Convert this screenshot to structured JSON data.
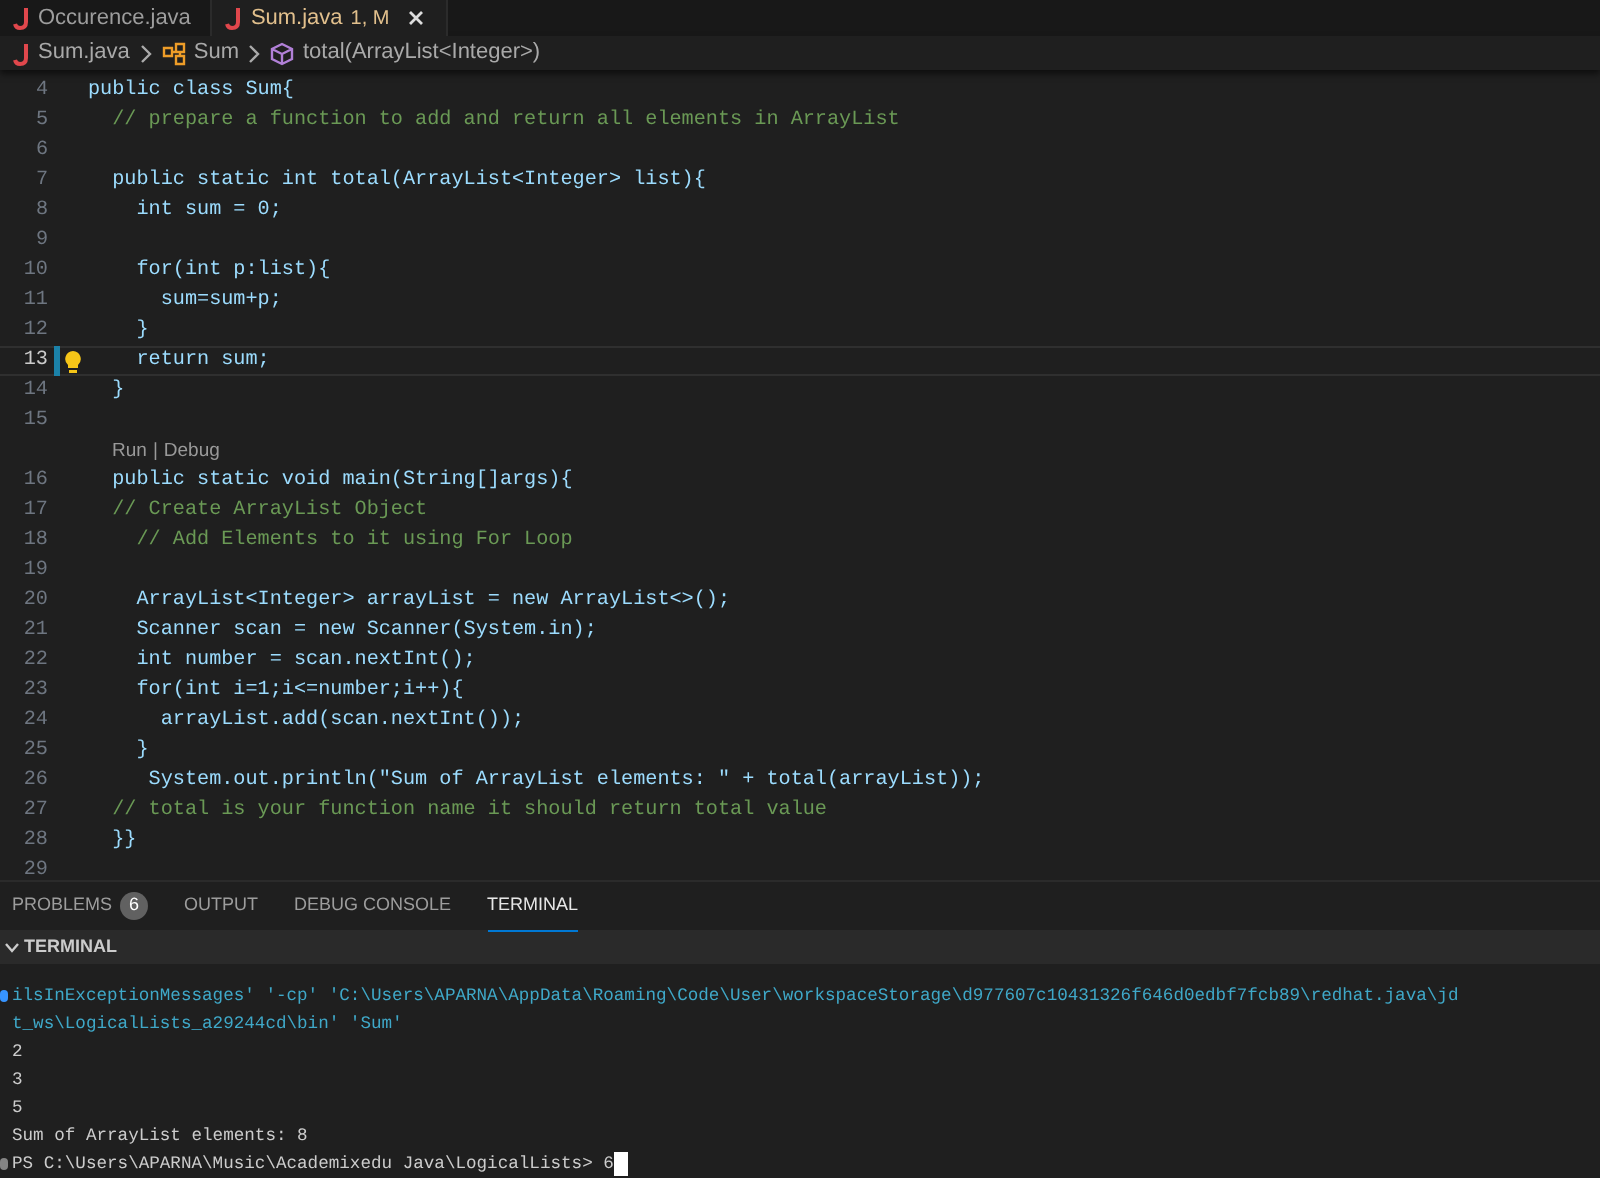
{
  "tabs": [
    {
      "label": "Occurence.java",
      "selected": false
    },
    {
      "label": "Sum.java",
      "badge": "1, M",
      "selected": true
    }
  ],
  "breadcrumbs": [
    {
      "label": "Sum.java",
      "kind": "file"
    },
    {
      "label": "Sum",
      "kind": "class"
    },
    {
      "label": "total(ArrayList<Integer>)",
      "kind": "method"
    }
  ],
  "editor": {
    "lines": [
      {
        "number": "4",
        "text": "public class Sum{",
        "kind": "code",
        "current": false,
        "lightbulb": false
      },
      {
        "number": "5",
        "text": "  // prepare a function to add and return all elements in ArrayList",
        "kind": "comment",
        "current": false,
        "lightbulb": false
      },
      {
        "number": "6",
        "kind": "code",
        "current": false,
        "lightbulb": false
      },
      {
        "number": "7",
        "text": "  public static int total(ArrayList<Integer> list){",
        "kind": "code",
        "current": false,
        "lightbulb": false
      },
      {
        "number": "8",
        "text": "    int sum = 0;",
        "kind": "code",
        "current": false,
        "lightbulb": false
      },
      {
        "number": "9",
        "kind": "code",
        "current": false,
        "lightbulb": false
      },
      {
        "number": "10",
        "text": "    for(int p:list){",
        "kind": "code",
        "current": false,
        "lightbulb": false
      },
      {
        "number": "11",
        "text": "      sum=sum+p;",
        "kind": "code",
        "current": false,
        "lightbulb": false
      },
      {
        "number": "12",
        "text": "    }",
        "kind": "code",
        "current": false,
        "lightbulb": false
      },
      {
        "number": "13",
        "text": "    return sum;",
        "kind": "code",
        "current": true,
        "lightbulb": true
      },
      {
        "number": "14",
        "text": "  }",
        "kind": "code",
        "current": false,
        "lightbulb": false
      },
      {
        "number": "15",
        "kind": "code",
        "current": false,
        "lightbulb": false
      },
      {
        "kind": "codelens",
        "links": [
          "Run",
          "Debug"
        ],
        "separator": "|"
      },
      {
        "number": "16",
        "text": "  public static void main(String[]args){",
        "kind": "code",
        "current": false,
        "lightbulb": false
      },
      {
        "number": "17",
        "text": "  // Create ArrayList Object",
        "kind": "comment",
        "current": false,
        "lightbulb": false
      },
      {
        "number": "18",
        "text": "    // Add Elements to it using For Loop",
        "kind": "comment",
        "current": false,
        "lightbulb": false
      },
      {
        "number": "19",
        "kind": "code",
        "current": false,
        "lightbulb": false
      },
      {
        "number": "20",
        "text": "    ArrayList<Integer> arrayList = new ArrayList<>();",
        "kind": "code",
        "current": false,
        "lightbulb": false
      },
      {
        "number": "21",
        "text": "    Scanner scan = new Scanner(System.in);",
        "kind": "code",
        "current": false,
        "lightbulb": false
      },
      {
        "number": "22",
        "text": "    int number = scan.nextInt();",
        "kind": "code",
        "current": false,
        "lightbulb": false
      },
      {
        "number": "23",
        "text": "    for(int i=1;i<=number;i++){",
        "kind": "code",
        "current": false,
        "lightbulb": false
      },
      {
        "number": "24",
        "text": "      arrayList.add(scan.nextInt());",
        "kind": "code",
        "current": false,
        "lightbulb": false
      },
      {
        "number": "25",
        "text": "    }",
        "kind": "code",
        "current": false,
        "lightbulb": false
      },
      {
        "number": "26",
        "text": "     System.out.println(\"Sum of ArrayList elements: \" + total(arrayList));",
        "kind": "code",
        "current": false,
        "lightbulb": false
      },
      {
        "number": "27",
        "text": "  // total is your function name it should return total value",
        "kind": "comment",
        "current": false,
        "lightbulb": false
      },
      {
        "number": "28",
        "text": "  }}",
        "kind": "code",
        "current": false,
        "lightbulb": false
      },
      {
        "number": "29",
        "kind": "code",
        "current": false,
        "lightbulb": false
      }
    ]
  },
  "panel_tabs": [
    {
      "label": "PROBLEMS",
      "badge": "6",
      "selected": false
    },
    {
      "label": "OUTPUT",
      "selected": false
    },
    {
      "label": "DEBUG CONSOLE",
      "selected": false
    },
    {
      "label": "TERMINAL",
      "selected": true
    }
  ],
  "terminal": {
    "title": "TERMINAL",
    "lines": [
      {
        "text": "ilsInExceptionMessages' '-cp' 'C:\\Users\\APARNA\\AppData\\Roaming\\Code\\User\\workspaceStorage\\d977607c10431326f646d0edbf7fcb89\\redhat.java\\jd",
        "kind": "command",
        "color": "#3794ff"
      },
      {
        "text": "t_ws\\LogicalLists_a29244cd\\bin' 'Sum'",
        "kind": "command"
      },
      {
        "text": "2",
        "kind": "output"
      },
      {
        "text": "3",
        "kind": "output"
      },
      {
        "text": "5",
        "kind": "output"
      },
      {
        "text": "Sum of ArrayList elements: 8",
        "kind": "output"
      },
      {
        "text": "PS C:\\Users\\APARNA\\Music\\Academixedu Java\\LogicalLists> 6",
        "kind": "prompt",
        "color": "#848484"
      }
    ]
  }
}
